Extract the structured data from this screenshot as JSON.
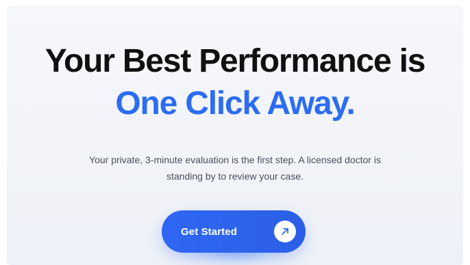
{
  "hero": {
    "headline_line1": "Your Best Performance is",
    "headline_line2": "One Click Away.",
    "subcopy": "Your private, 3-minute evaluation is the first step. A licensed doctor is standing by to review your case."
  },
  "cta": {
    "label": "Get Started",
    "icon": "arrow-up-right-icon"
  },
  "colors": {
    "headline_text": "#111111",
    "accent_blue": "#2b6cf2",
    "button_blue": "#2f67f5",
    "body_text": "#4a4f5a",
    "background": "#f3f5fa"
  }
}
